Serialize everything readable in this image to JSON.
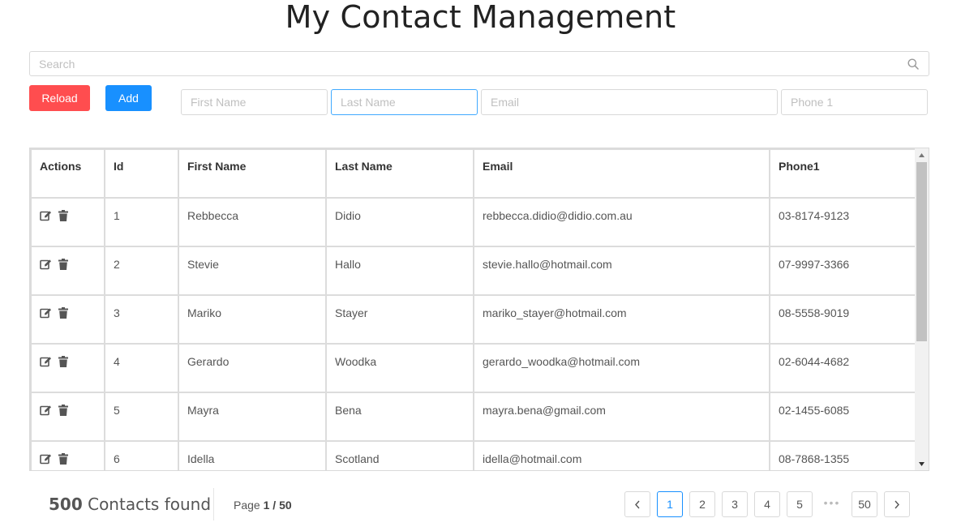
{
  "header": {
    "title": "My Contact Management"
  },
  "search": {
    "placeholder": "Search"
  },
  "toolbar": {
    "reload_label": "Reload",
    "add_label": "Add",
    "first_name_placeholder": "First Name",
    "last_name_placeholder": "Last Name",
    "email_placeholder": "Email",
    "phone_placeholder": "Phone 1"
  },
  "table": {
    "columns": [
      "Actions",
      "Id",
      "First Name",
      "Last Name",
      "Email",
      "Phone1"
    ],
    "rows": [
      {
        "id": "1",
        "first": "Rebbecca",
        "last": "Didio",
        "email": "rebbecca.didio@didio.com.au",
        "phone": "03-8174-9123"
      },
      {
        "id": "2",
        "first": "Stevie",
        "last": "Hallo",
        "email": "stevie.hallo@hotmail.com",
        "phone": "07-9997-3366"
      },
      {
        "id": "3",
        "first": "Mariko",
        "last": "Stayer",
        "email": "mariko_stayer@hotmail.com",
        "phone": "08-5558-9019"
      },
      {
        "id": "4",
        "first": "Gerardo",
        "last": "Woodka",
        "email": "gerardo_woodka@hotmail.com",
        "phone": "02-6044-4682"
      },
      {
        "id": "5",
        "first": "Mayra",
        "last": "Bena",
        "email": "mayra.bena@gmail.com",
        "phone": "02-1455-6085"
      },
      {
        "id": "6",
        "first": "Idella",
        "last": "Scotland",
        "email": "idella@hotmail.com",
        "phone": "08-7868-1355"
      }
    ]
  },
  "footer": {
    "count": "500",
    "count_label": "Contacts found",
    "page_prefix": "Page",
    "current_page": "1",
    "page_sep": "/",
    "total_pages": "50",
    "pages": [
      "1",
      "2",
      "3",
      "4",
      "5",
      "50"
    ],
    "ellipsis": "•••"
  },
  "colors": {
    "reload": "#ff4d4f",
    "add": "#1890ff",
    "active_page": "#1890ff"
  },
  "icons": {
    "edit": "edit-icon",
    "delete": "trash-icon",
    "search": "search-icon"
  }
}
